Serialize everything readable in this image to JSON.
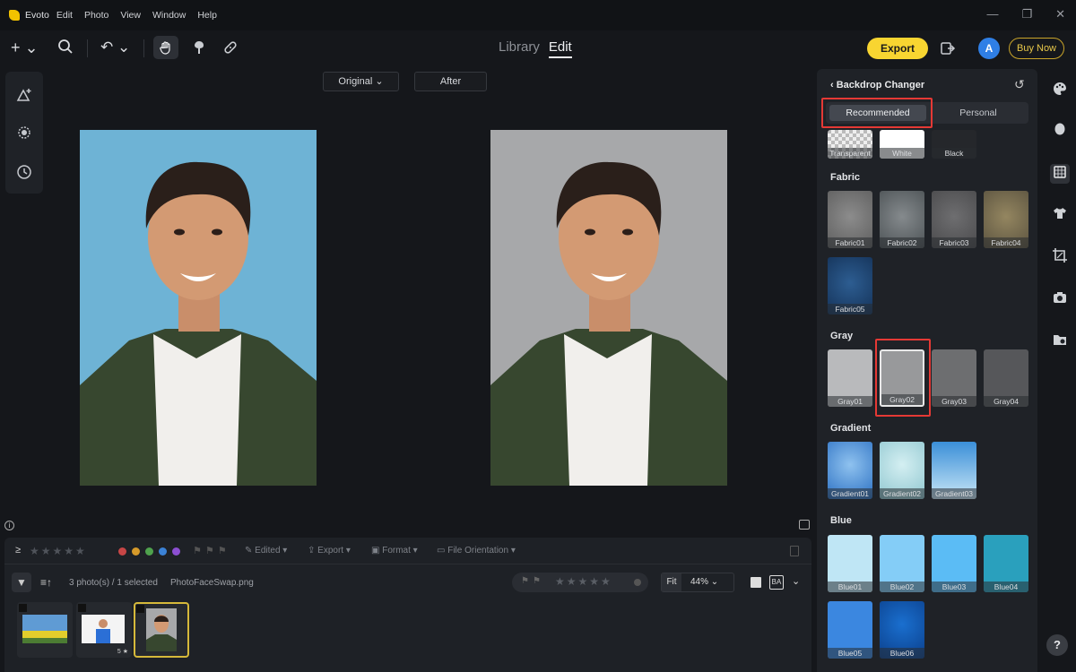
{
  "app": {
    "title": "Evoto"
  },
  "menu": [
    "Edit",
    "Photo",
    "View",
    "Window",
    "Help"
  ],
  "window_controls": {
    "minimize": "—",
    "restore": "❐",
    "close": "✕"
  },
  "toolbar": {
    "add_glyph": "+ ⌄",
    "undo_glyph": "↶ ⌄",
    "mode_library": "Library",
    "mode_edit": "Edit",
    "export_label": "Export",
    "avatar_letter": "A",
    "buy_label": "Buy Now"
  },
  "compare": {
    "original_label": "Original ⌄",
    "after_label": "After"
  },
  "film": {
    "rating_prefix": "≥",
    "stars": "★★★★★",
    "edited": "✎ Edited ▾",
    "export": "⇪ Export ▾",
    "format": "▣ Format ▾",
    "orientation": "▭ File Orientation ▾",
    "sort_glyph": "≡↑",
    "count": "3 photo(s) / 1 selected",
    "filename": "PhotoFaceSwap.png",
    "row2_stars": "★★★★★",
    "fit": "Fit",
    "zoom": "44% ⌄",
    "ba": "BA",
    "thumb2_rating": "5 ★"
  },
  "panel": {
    "title": "‹  Backdrop Changer",
    "reset_glyph": "↺",
    "tab_recommended": "Recommended",
    "tab_personal": "Personal",
    "basic": [
      "Transparent",
      "White",
      "Black"
    ],
    "fabric_label": "Fabric",
    "fabric": [
      "Fabric01",
      "Fabric02",
      "Fabric03",
      "Fabric04",
      "Fabric05"
    ],
    "gray_label": "Gray",
    "gray": [
      "Gray01",
      "Gray02",
      "Gray03",
      "Gray04"
    ],
    "gradient_label": "Gradient",
    "gradient": [
      "Gradient01",
      "Gradient02",
      "Gradient03"
    ],
    "blue_label": "Blue",
    "blue": [
      "Blue01",
      "Blue02",
      "Blue03",
      "Blue04",
      "Blue05",
      "Blue06"
    ]
  },
  "colors": {
    "accent": "#f8d531",
    "selection_highlight": "#e53935",
    "original_backdrop": "#6eb3d5",
    "after_backdrop": "#a7a8aa",
    "label_dots": [
      "#c74646",
      "#d69a2a",
      "#4fa24d",
      "#3b82d6",
      "#8c4fd2"
    ]
  },
  "help_glyph": "?"
}
